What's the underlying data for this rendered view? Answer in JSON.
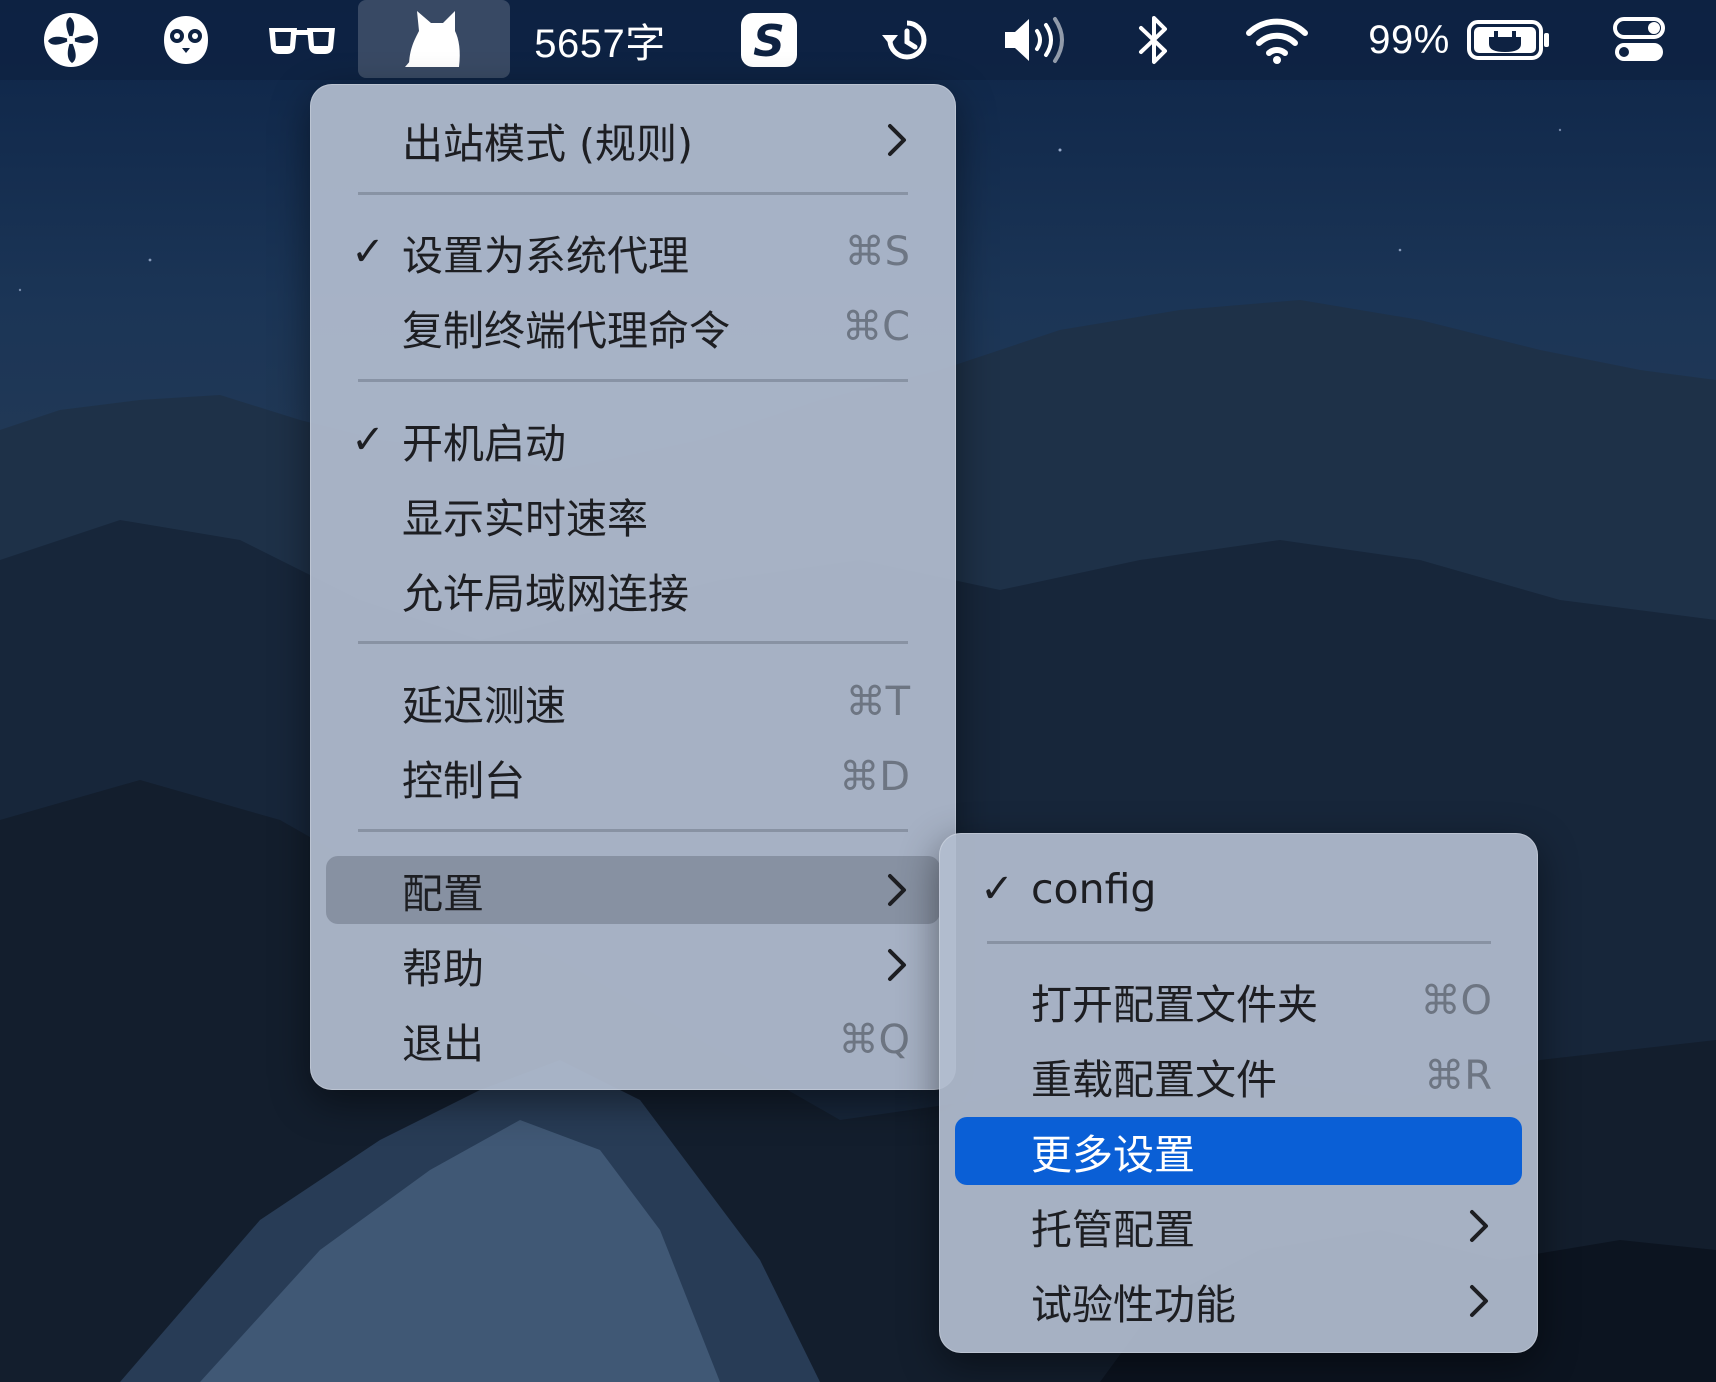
{
  "menubar": {
    "items": [
      {
        "name": "pinwheel-icon"
      },
      {
        "name": "owl-icon"
      },
      {
        "name": "glasses-icon"
      },
      {
        "name": "cat-icon"
      },
      {
        "name": "word-count",
        "text": "5657字"
      },
      {
        "name": "s-app-icon"
      },
      {
        "name": "time-machine-icon"
      },
      {
        "name": "volume-icon"
      },
      {
        "name": "bluetooth-icon"
      },
      {
        "name": "wifi-icon"
      },
      {
        "name": "battery-percent",
        "text": "99%"
      },
      {
        "name": "battery-charging-icon"
      },
      {
        "name": "control-center-icon"
      }
    ],
    "word_count": "5657字",
    "battery_percent": "99%"
  },
  "main_menu": {
    "items": [
      {
        "label": "出站模式 (规则)",
        "checked": false,
        "shortcut": "",
        "submenu": true
      },
      {
        "label": "设置为系统代理",
        "checked": true,
        "shortcut": "⌘S",
        "submenu": false
      },
      {
        "label": "复制终端代理命令",
        "checked": false,
        "shortcut": "⌘C",
        "submenu": false
      },
      {
        "label": "开机启动",
        "checked": true,
        "shortcut": "",
        "submenu": false
      },
      {
        "label": "显示实时速率",
        "checked": false,
        "shortcut": "",
        "submenu": false
      },
      {
        "label": "允许局域网连接",
        "checked": false,
        "shortcut": "",
        "submenu": false
      },
      {
        "label": "延迟测速",
        "checked": false,
        "shortcut": "⌘T",
        "submenu": false
      },
      {
        "label": "控制台",
        "checked": false,
        "shortcut": "⌘D",
        "submenu": false
      },
      {
        "label": "配置",
        "checked": false,
        "shortcut": "",
        "submenu": true,
        "state": "hover"
      },
      {
        "label": "帮助",
        "checked": false,
        "shortcut": "",
        "submenu": true
      },
      {
        "label": "退出",
        "checked": false,
        "shortcut": "⌘Q",
        "submenu": false
      }
    ],
    "check_glyph": "✓"
  },
  "config_submenu": {
    "items": [
      {
        "label": "config",
        "checked": true,
        "shortcut": "",
        "submenu": false
      },
      {
        "label": "打开配置文件夹",
        "checked": false,
        "shortcut": "⌘O",
        "submenu": false
      },
      {
        "label": "重载配置文件",
        "checked": false,
        "shortcut": "⌘R",
        "submenu": false
      },
      {
        "label": "更多设置",
        "checked": false,
        "shortcut": "",
        "submenu": false,
        "state": "selected"
      },
      {
        "label": "托管配置",
        "checked": false,
        "shortcut": "",
        "submenu": true
      },
      {
        "label": "试验性功能",
        "checked": false,
        "shortcut": "",
        "submenu": true
      }
    ]
  },
  "colors": {
    "menubar_bg": "#0e2242",
    "menu_bg": "#b2bccf",
    "highlight_blue": "#0a5fd6",
    "hover_gray": "#6e7686"
  }
}
